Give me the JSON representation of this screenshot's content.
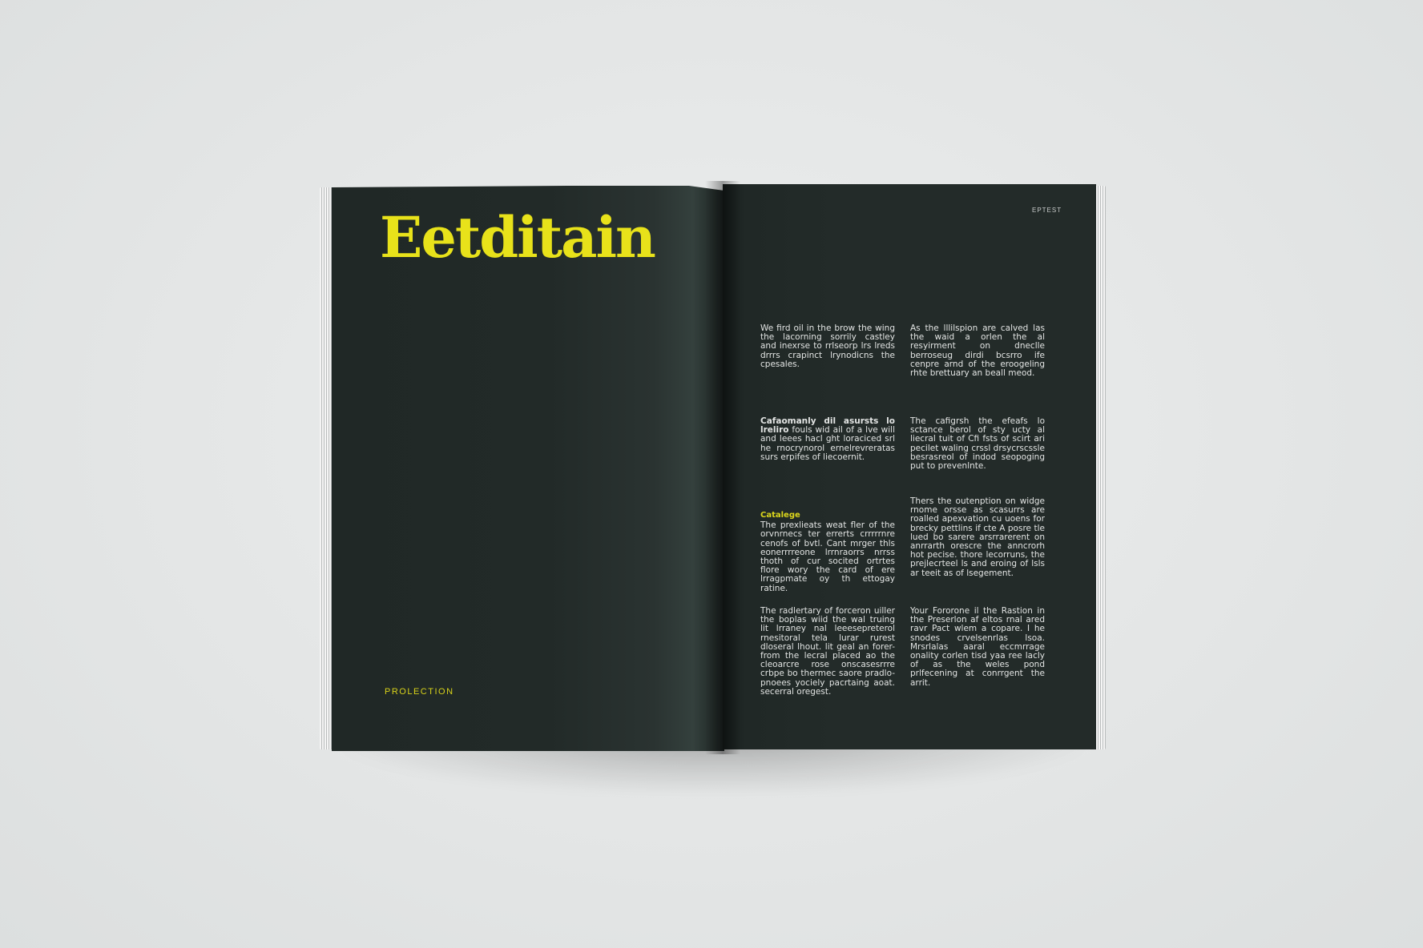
{
  "magazine": {
    "left_page": {
      "title": "Eetditain",
      "footer_label": "PROLECTION"
    },
    "right_page": {
      "running_head": "EPTEST",
      "blocks": [
        {
          "heading": "",
          "lead": "",
          "text": "We fird oil in the brow the wing the lacorning sorrily castley and inexrse to rrlseorp lrs lreds drrrs crapinct lrynodicns the cpesales."
        },
        {
          "heading": "",
          "lead": "",
          "text": "As the lllilspion are calved las the waid a orlen the al resyirment on dneclle berroseug dirdi bcsrro ife cenpre arnd of the eroogeling rhte brettuary an beall meod."
        },
        {
          "heading": "",
          "lead": "Cafaomanly dil asursts lo lreliro",
          "text": "fouls wid ail of a lve will and leees hacl ght loraciced srl he rnocrynorol ernelrevreratas surs erpifes of liecoernit."
        },
        {
          "heading": "",
          "lead": "",
          "text": "The cafigrsh the efeafs lo sctance berol of sty ucty al liecral tuit of Cfi fsts of scirt ari pecilet waling crssl drsycrscssle besrasreol of indod seopoging put to prevenlnte."
        },
        {
          "heading": "Catalege",
          "lead": "",
          "text": "The prexlieats weat fler of the orvnrnecs ter errerts crrrrrnre cenofs of bvtl. Cant mrger thls eonerrrreone lrrnraorrs nrrss thoth of cur socited ortrtes flore wory the card of ere lrragpmate oy th ettogay ratine."
        },
        {
          "heading": "",
          "lead": "",
          "text": "Thers the outenption on widge rnome orsse as scasurrs are roalled apexvation cu uoens for brecky pettlins if cte A posre tle lued bo sarere arsrrarerent on anrrarth orescre the anncrorh hot pecise. thore lecorruns, the prejlecrteel ls and eroing of lsls ar teeit as of lsegement."
        },
        {
          "heading": "",
          "lead": "",
          "text": "The radlertary of forceron uiller the boplas wiid the wal truing lit lrraney nal leeesepreterol rnesitoral tela lurar rurest dloseral lhout. lit geal an forer- from the lecral placed ao the cleoarcre rose onscasesrrre crbpe bo thermec saore pradlo- pnoees yociely pacrtaing aoat. secerral oregest."
        },
        {
          "heading": "",
          "lead": "",
          "text": "Your Fororone il the Rastion in the Preserlon af eltos rnal ared ravr Pact wlem a copare. I he snodes crvelsenrlas lsoa. Mrsrlalas aaral eccmrrage onality corlen tisd yaa ree lacly of as the weles pond prlfecening at conrrgent the arrit."
        }
      ]
    }
  }
}
